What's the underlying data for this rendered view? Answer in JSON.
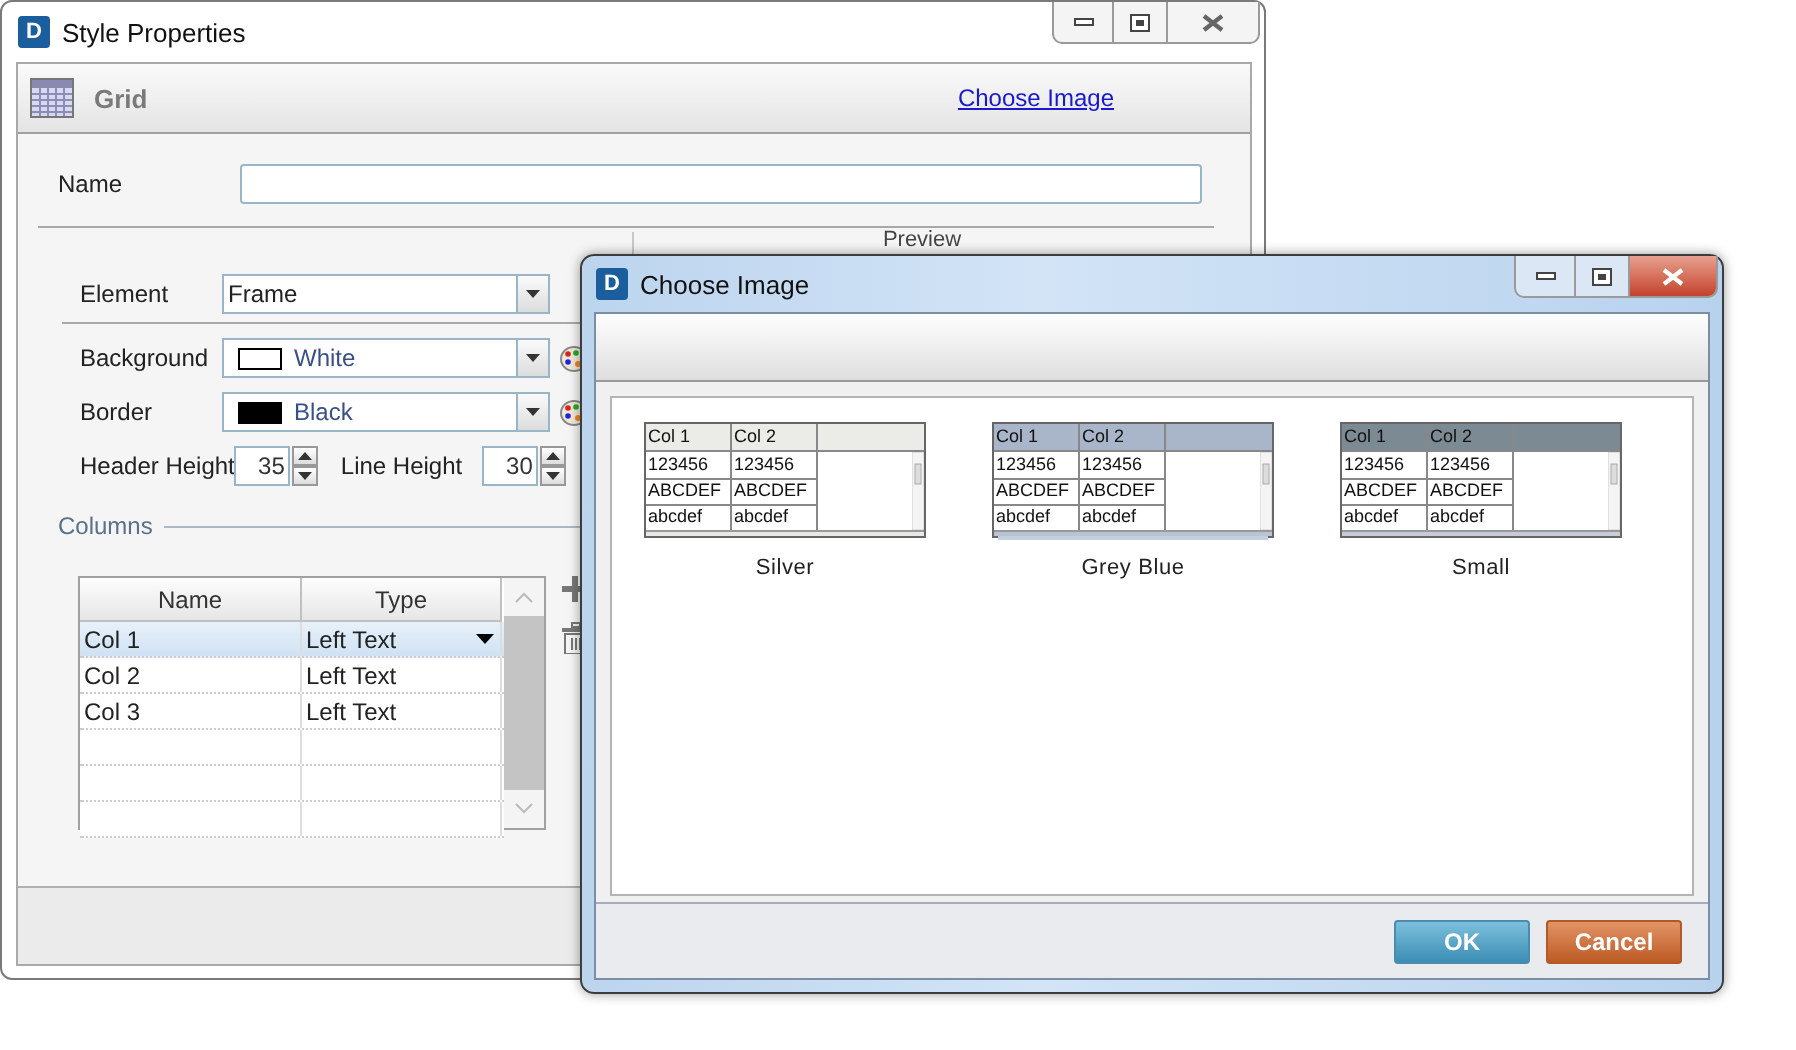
{
  "main_window": {
    "logo": "D",
    "title": "Style Properties",
    "header": {
      "title": "Grid",
      "link": "Choose Image"
    },
    "name_field": {
      "label": "Name"
    },
    "element": {
      "label": "Element",
      "value": "Frame"
    },
    "background": {
      "label": "Background",
      "value": "White",
      "color": "#ffffff"
    },
    "border": {
      "label": "Border",
      "value": "Black",
      "color": "#000000"
    },
    "header_height": {
      "label": "Header Height",
      "value": "35"
    },
    "line_height": {
      "label": "Line Height",
      "value": "30"
    },
    "preview_label": "Preview",
    "columns": {
      "title": "Columns",
      "headers": [
        "Name",
        "Type"
      ],
      "rows": [
        {
          "name": "Col 1",
          "type": "Left Text",
          "selected": true
        },
        {
          "name": "Col 2",
          "type": "Left Text",
          "selected": false
        },
        {
          "name": "Col 3",
          "type": "Left Text",
          "selected": false
        }
      ]
    }
  },
  "dialog": {
    "logo": "D",
    "title": "Choose Image",
    "images": [
      {
        "label": "Silver",
        "kind": "silver",
        "headers": [
          "Col 1",
          "Col 2"
        ],
        "rows": [
          [
            "123456",
            "123456"
          ],
          [
            "ABCDEF",
            "ABCDEF"
          ],
          [
            "abcdef",
            "abcdef"
          ]
        ]
      },
      {
        "label": "Grey Blue",
        "kind": "greyblue",
        "headers": [
          "Col 1",
          "Col 2"
        ],
        "rows": [
          [
            "123456",
            "123456"
          ],
          [
            "ABCDEF",
            "ABCDEF"
          ],
          [
            "abcdef",
            "abcdef"
          ]
        ]
      },
      {
        "label": "Small",
        "kind": "small",
        "headers": [
          "Col 1",
          "Col 2"
        ],
        "rows": [
          [
            "123456",
            "123456"
          ],
          [
            "ABCDEF",
            "ABCDEF"
          ],
          [
            "abcdef",
            "abcdef"
          ]
        ]
      }
    ],
    "buttons": [
      {
        "label": "OK",
        "kind": "primary"
      },
      {
        "label": "Cancel",
        "kind": "cancel"
      }
    ]
  }
}
